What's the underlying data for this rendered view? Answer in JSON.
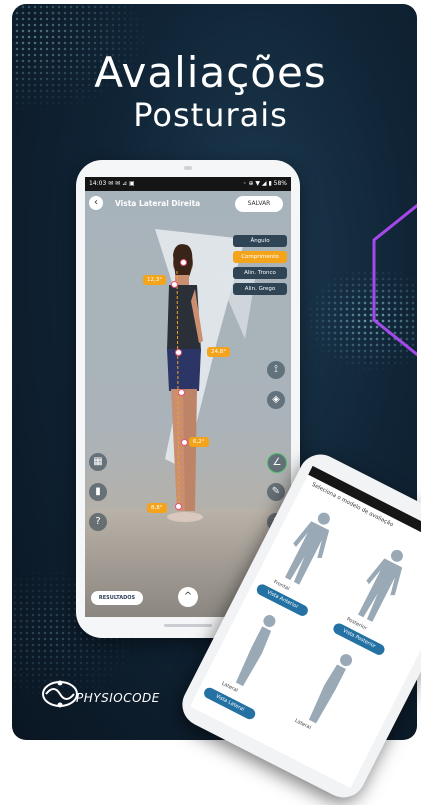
{
  "headline": {
    "line1": "Avaliações",
    "line2": "Posturais"
  },
  "phone_main": {
    "status_left": "14:03 ✉ ✉ ⊿ ▣",
    "status_right": "◦ ⊕ ▼ ◢ ▮ 58%",
    "screen_title": "Vista Lateral Direita",
    "save_label": "SALVAR",
    "chips": [
      "Ângulo",
      "Comprimento",
      "Alin. Tronco",
      "Alin. Grego"
    ],
    "measure_tags": [
      "12,3°",
      "24,8°",
      "6,2°",
      "8,8°"
    ],
    "result_label": "RESULTADOS",
    "up_label": "^"
  },
  "phone_secondary": {
    "header_text": "Seleciona o modelo de avaliação",
    "captions": [
      "Frontal",
      "Posterior",
      "Lateral",
      "Lateral"
    ],
    "view_buttons": [
      "Vista Anterior",
      "Vista Posterior",
      "Vista Lateral"
    ]
  },
  "brand": {
    "name": "PHYSIOCODE"
  },
  "colors": {
    "accent": "#f3a41b",
    "background": "#102436",
    "neon": "#b64cff"
  }
}
